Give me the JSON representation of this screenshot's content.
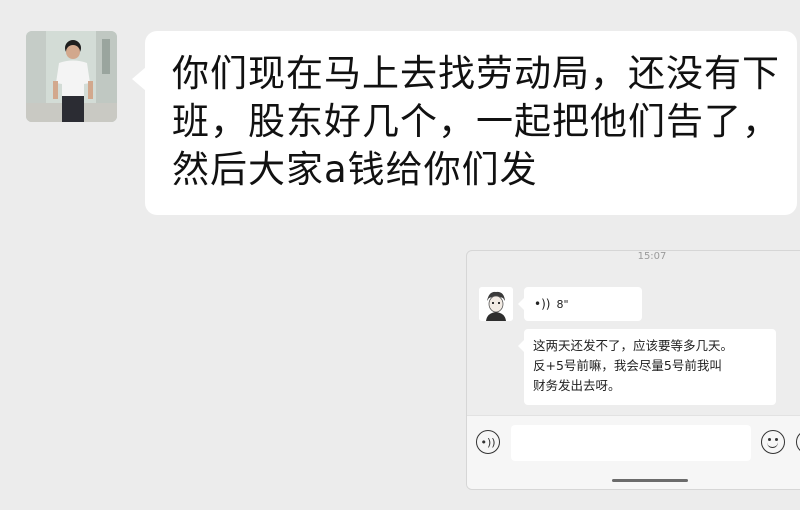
{
  "chat": {
    "message_lines": [
      "你们现在马上去找劳动局，还没有下",
      "班，股东好几个，一起把他们告了，",
      "然后大家a钱给你们发"
    ]
  },
  "inset": {
    "timestamp": "15:07",
    "voice_message": {
      "duration": "8\""
    },
    "reply_lines": [
      "这两天还发不了，应该要等多几天。",
      "反+5号前嘛，我会尽量5号前我叫",
      "财务发出去呀。"
    ],
    "input": {
      "value": "",
      "placeholder": ""
    },
    "icons": {
      "voice": "voice-input-icon",
      "emoji": "emoji-icon",
      "more": "plus-more-icon",
      "wave": "voice-wave-icon"
    }
  },
  "colors": {
    "background": "#ececec",
    "bubble": "#ffffff",
    "text": "#111111"
  }
}
